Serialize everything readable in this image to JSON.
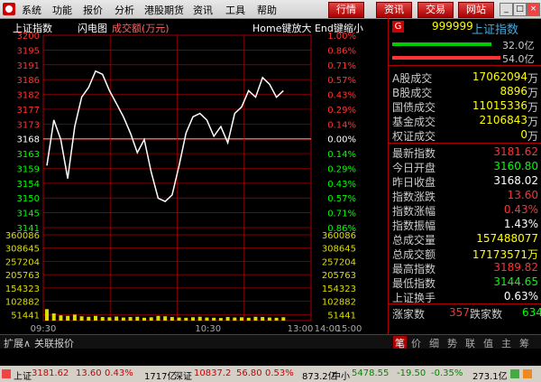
{
  "menu": {
    "items": [
      "系统",
      "功能",
      "报价",
      "分析",
      "港股期货",
      "资讯",
      "工具",
      "帮助"
    ],
    "buttons": [
      "行情",
      "资讯",
      "交易",
      "网站"
    ]
  },
  "chart": {
    "title": "上证指数",
    "tab_active": "闪电图",
    "tab_volume": "成交额(万元)",
    "hint": "Home键放大 End键缩小",
    "price_ticks": [
      "3200",
      "3195",
      "3191",
      "3186",
      "3182",
      "3177",
      "3173",
      "3168",
      "3163",
      "3159",
      "3154",
      "3150",
      "3145",
      "3141"
    ],
    "pct_ticks": [
      "1.00%",
      "0.86%",
      "0.71%",
      "0.57%",
      "0.43%",
      "0.29%",
      "0.14%",
      "0.00%",
      "0.14%",
      "0.29%",
      "0.43%",
      "0.57%",
      "0.71%",
      "0.86%"
    ],
    "vol_ticks": [
      "360086",
      "308645",
      "257204",
      "205763",
      "154323",
      "102882",
      "51441"
    ],
    "time_ticks": [
      "09:30",
      "10:30",
      "13:00",
      "14:00",
      "15:00"
    ],
    "colors": {
      "up": "#ff3333",
      "down": "#00ff00",
      "grid": "#aa0000",
      "line": "#ffffff",
      "volume": "#dddd00"
    }
  },
  "chart_data": {
    "type": "line",
    "title": "上证指数",
    "ylim": [
      3141,
      3200
    ],
    "prev_close": 3168.02,
    "x": [
      "09:30",
      "09:35",
      "09:40",
      "09:45",
      "09:50",
      "09:55",
      "10:00",
      "10:05",
      "10:10",
      "10:15",
      "10:20",
      "10:25",
      "10:30",
      "10:35",
      "10:40",
      "10:45",
      "10:50",
      "10:55",
      "11:00",
      "11:05",
      "11:10",
      "11:15",
      "11:20",
      "11:25",
      "11:30",
      "13:00",
      "13:05",
      "13:10",
      "13:15",
      "13:20",
      "13:25",
      "13:30",
      "13:35",
      "13:40",
      "13:45"
    ],
    "series": [
      {
        "values": [
          3160,
          3174,
          3168,
          3156,
          3172,
          3181,
          3184,
          3189,
          3188,
          3183,
          3179,
          3175,
          3170,
          3164,
          3168,
          3158,
          3150,
          3149,
          3151,
          3160,
          3170,
          3175,
          3176,
          3174,
          3169,
          3172,
          3167,
          3176,
          3178,
          3183,
          3181,
          3187,
          3185,
          3181,
          3183
        ]
      }
    ],
    "volume": [
      48000,
      30000,
      22000,
      20000,
      25000,
      18000,
      16000,
      20000,
      15000,
      14000,
      17000,
      13000,
      15000,
      16000,
      12000,
      14000,
      20000,
      18000,
      15000,
      13000,
      12000,
      14000,
      16000,
      13000,
      12000,
      11000,
      15000,
      13000,
      14000,
      12000,
      16000,
      15000,
      13000,
      12000,
      14000
    ],
    "volume_ylim": [
      0,
      360086
    ]
  },
  "quote": {
    "code": "999999",
    "name": "上证指数",
    "bar1": "32.0亿",
    "bar2": "54.0亿",
    "rows": [
      {
        "label": "A股成交",
        "value": "17062094",
        "unit": "万",
        "color": "#ffff00"
      },
      {
        "label": "B股成交",
        "value": "8896",
        "unit": "万",
        "color": "#ffff00"
      },
      {
        "label": "国债成交",
        "value": "11015336",
        "unit": "万",
        "color": "#ffff00"
      },
      {
        "label": "基金成交",
        "value": "2106843",
        "unit": "万",
        "color": "#ffff00"
      },
      {
        "label": "权证成交",
        "value": "0",
        "unit": "万",
        "color": "#ffff00"
      }
    ],
    "rows2": [
      {
        "label": "最新指数",
        "value": "3181.62",
        "color": "#ff3333"
      },
      {
        "label": "今日开盘",
        "value": "3160.80",
        "color": "#00ff00"
      },
      {
        "label": "昨日收盘",
        "value": "3168.02",
        "color": "#ffffff"
      },
      {
        "label": "指数涨跌",
        "value": "13.60",
        "color": "#ff3333"
      },
      {
        "label": "指数涨幅",
        "value": "0.43%",
        "color": "#ff3333"
      },
      {
        "label": "指数振幅",
        "value": "1.43%",
        "color": "#ffffff"
      },
      {
        "label": "总成交量",
        "value": "157488077",
        "color": "#ffff00"
      },
      {
        "label": "总成交额",
        "value": "17173571万",
        "color": "#ffff00"
      },
      {
        "label": "最高指数",
        "value": "3189.82",
        "color": "#ff3333"
      },
      {
        "label": "最低指数",
        "value": "3144.65",
        "color": "#00ff00"
      },
      {
        "label": "上证换手",
        "value": "0.63%",
        "color": "#ffffff"
      }
    ],
    "up_label": "涨家数",
    "up_count": "357",
    "down_label": "跌家数",
    "down_count": "634",
    "tabs": [
      "笔",
      "价",
      "细",
      "势",
      "联",
      "值",
      "主",
      "筹"
    ]
  },
  "bottom_tabs": [
    "扩展∧",
    "关联报价"
  ],
  "status": {
    "sh_label": "上证",
    "sh_price": "3181.62",
    "sh_chg": "13.60",
    "sh_pct": "0.43%",
    "sh_amt": "1717亿",
    "sz_label": "深证",
    "sz_price": "10837.2",
    "sz_chg": "56.80",
    "sz_pct": "0.53%",
    "sz_amt": "873.2亿",
    "zx_label": "中小",
    "zx_price": "5478.55",
    "zx_chg": "-19.50",
    "zx_pct": "-0.35%",
    "zx_amt": "273.1亿"
  }
}
